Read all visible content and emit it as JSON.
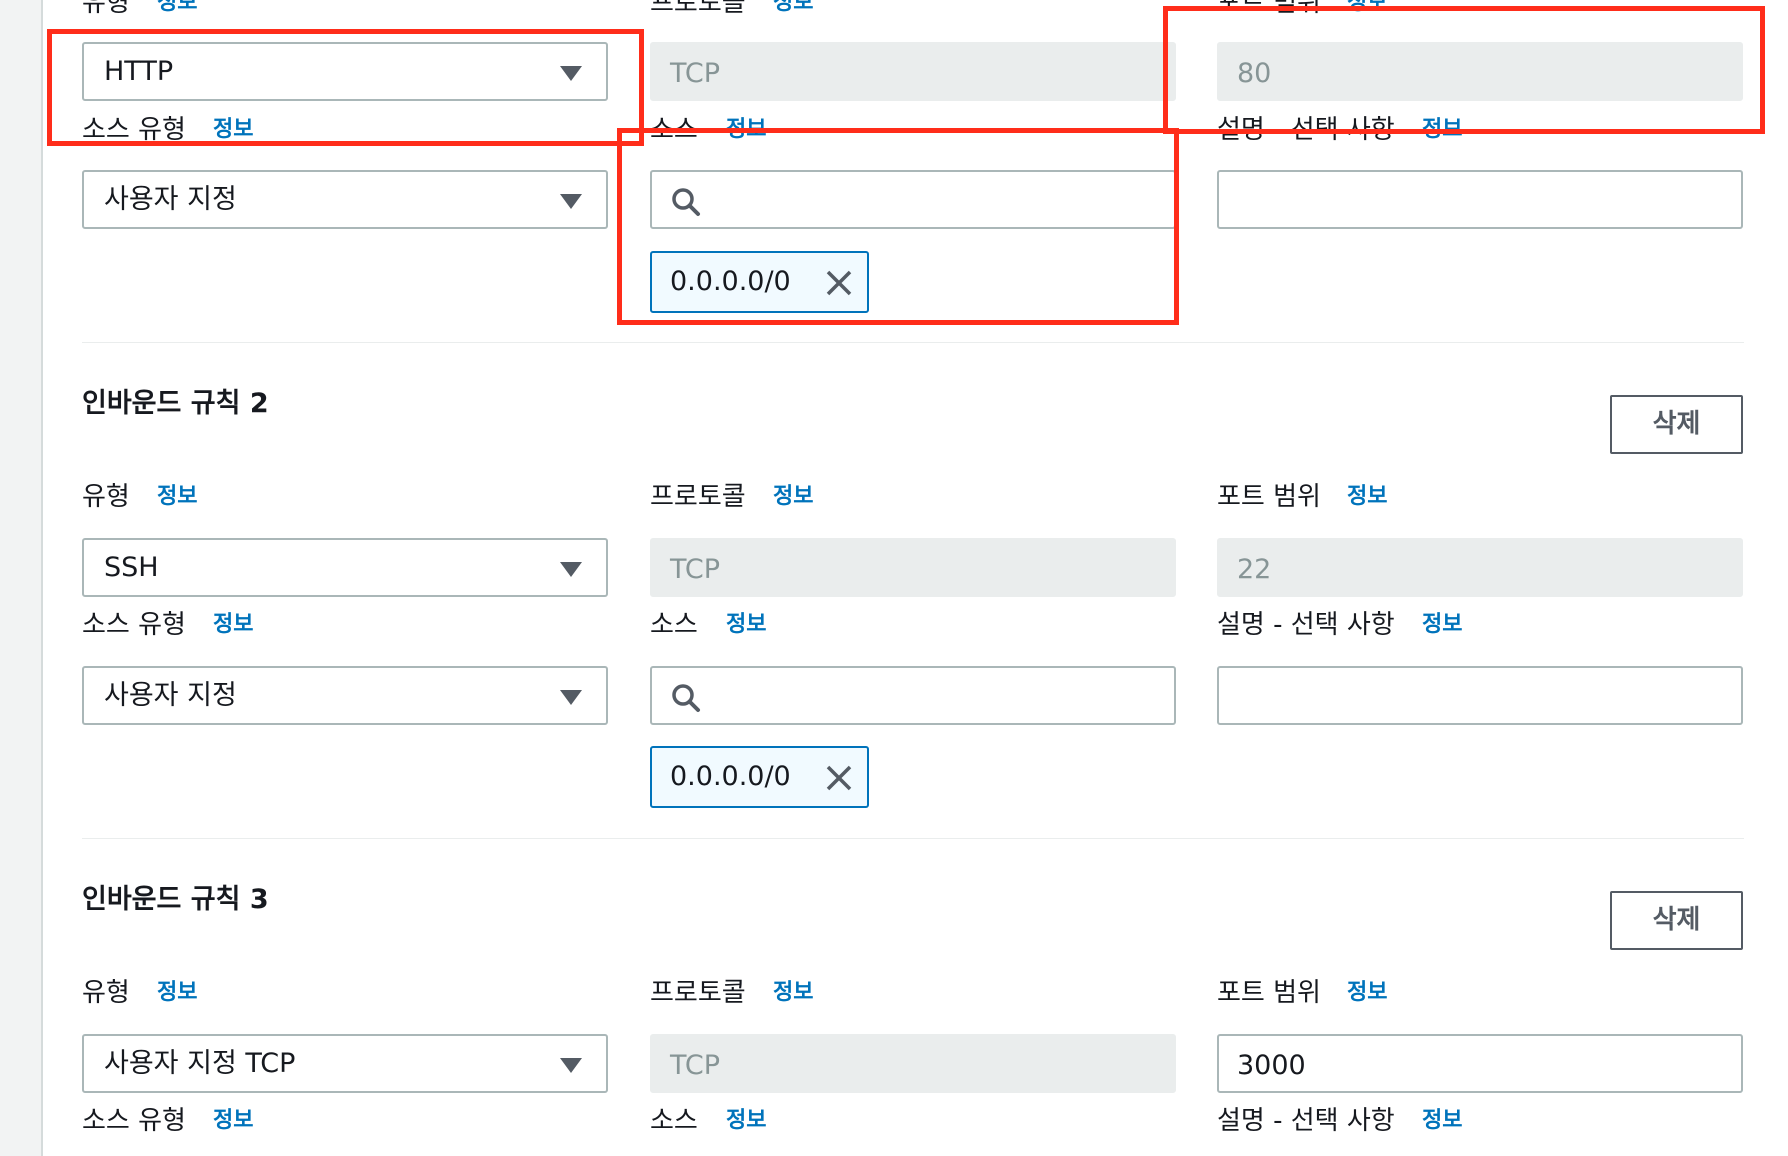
{
  "info_label": "정보",
  "fields": {
    "type_label": "유형",
    "protocol_label": "프로토콜",
    "port_range_label": "포트 범위",
    "source_type_label": "소스 유형",
    "source_label": "소스",
    "description_label": "설명 - 선택 사항"
  },
  "rules": [
    {
      "type": "HTTP",
      "protocol": "TCP",
      "port_range": "80",
      "source_type": "사용자 지정",
      "source_token": "0.0.0.0/0"
    },
    {
      "title": "인바운드 규칙 2",
      "delete_label": "삭제",
      "type": "SSH",
      "protocol": "TCP",
      "port_range": "22",
      "source_type": "사용자 지정",
      "source_token": "0.0.0.0/0"
    },
    {
      "title": "인바운드 규칙 3",
      "delete_label": "삭제",
      "type": "사용자 지정 TCP",
      "protocol": "TCP",
      "port_range": "3000"
    }
  ],
  "icons": {
    "dropdown": "caret-down-icon",
    "search": "search-icon",
    "remove": "close-icon"
  },
  "colors": {
    "info_link": "#0073bb",
    "token_border": "#0073bb",
    "annotation_highlight": "#ff2d1a"
  }
}
